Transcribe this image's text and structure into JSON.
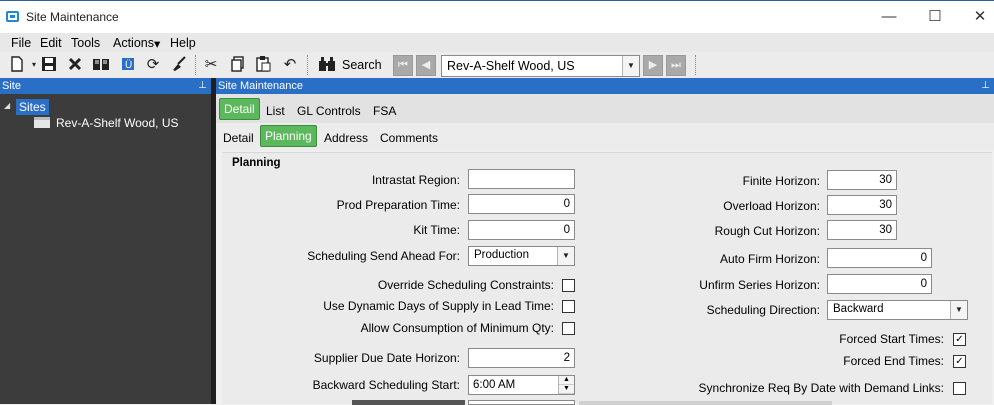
{
  "window": {
    "title": "Site Maintenance",
    "controls": {
      "minimize": "—",
      "maximize": "☐",
      "close": "✕"
    }
  },
  "menu": {
    "items": [
      "File",
      "Edit",
      "Tools",
      "Actions",
      "Help"
    ],
    "actions_caret": "▾"
  },
  "toolbar": {
    "icons": [
      "new-icon",
      "save-icon",
      "delete-icon",
      "book-icon",
      "attach-icon",
      "refresh-icon",
      "clear-icon",
      "cut-icon",
      "copy-icon",
      "paste-icon",
      "undo-icon",
      "search-icon"
    ],
    "search_label": "Search",
    "record_value": "Rev-A-Shelf Wood, US"
  },
  "left_panel": {
    "header": "Site",
    "tree_root": "Sites",
    "tree_child": "Rev-A-Shelf Wood, US"
  },
  "main_panel": {
    "header": "Site Maintenance",
    "tabs": [
      "Detail",
      "List",
      "GL Controls",
      "FSA"
    ],
    "active_tab": "Detail",
    "subtabs": [
      "Detail",
      "Planning",
      "Address",
      "Comments"
    ],
    "active_subtab": "Planning",
    "accent_color": "#5cb85c",
    "header_color": "#2a6fc6"
  },
  "planning": {
    "section_title": "Planning",
    "left_fields": [
      {
        "label": "Intrastat Region:",
        "value": ""
      },
      {
        "label": "Prod Preparation Time:",
        "value": "0"
      },
      {
        "label": "Kit Time:",
        "value": "0"
      },
      {
        "label": "Scheduling Send Ahead For:",
        "value": "Production"
      },
      {
        "label": "Override Scheduling Constraints:",
        "checked": false
      },
      {
        "label": "Use Dynamic Days of Supply in Lead Time:",
        "checked": false
      },
      {
        "label": "Allow Consumption of Minimum Qty:",
        "checked": false
      },
      {
        "label": "Supplier Due Date Horizon:",
        "value": "2"
      },
      {
        "label": "Backward Scheduling Start:",
        "value": "6:00 AM"
      }
    ],
    "right_fields": [
      {
        "label": "Finite Horizon:",
        "value": "30"
      },
      {
        "label": "Overload Horizon:",
        "value": "30"
      },
      {
        "label": "Rough Cut Horizon:",
        "value": "30"
      },
      {
        "label": "Auto Firm Horizon:",
        "value": "0"
      },
      {
        "label": "Unfirm Series Horizon:",
        "value": "0"
      },
      {
        "label": "Scheduling Direction:",
        "value": "Backward"
      },
      {
        "label": "Forced Start Times:",
        "checked": true
      },
      {
        "label": "Forced End Times:",
        "checked": true
      },
      {
        "label": "Synchronize Req By Date with Demand Links:",
        "checked": false
      }
    ]
  }
}
